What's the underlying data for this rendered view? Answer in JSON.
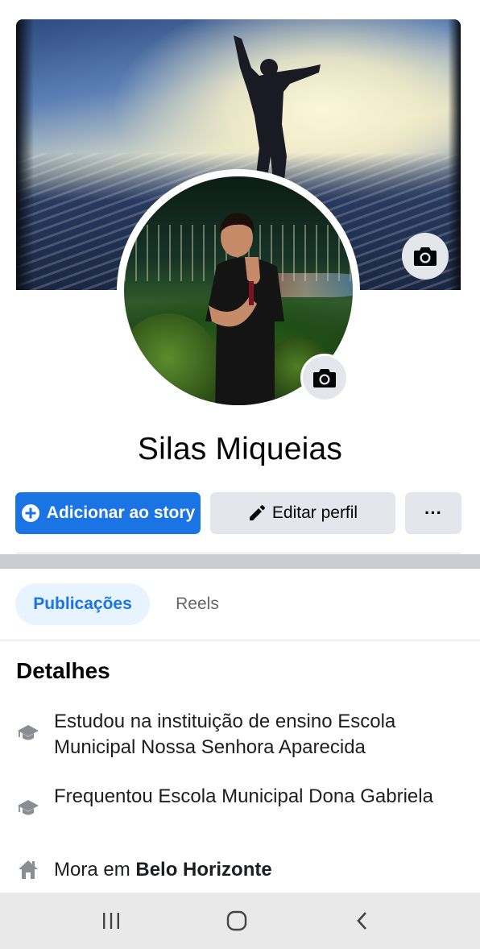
{
  "profile": {
    "name": "Silas Miqueias"
  },
  "actions": {
    "add_story_label": "Adicionar ao story",
    "edit_profile_label": "Editar perfil",
    "more_label": "···"
  },
  "tabs": [
    {
      "label": "Publicações",
      "active": true
    },
    {
      "label": "Reels",
      "active": false
    }
  ],
  "details": {
    "title": "Detalhes",
    "items": [
      {
        "icon": "graduation-cap-icon",
        "text": "Estudou na instituição de ensino Escola Municipal Nossa Senhora Aparecida"
      },
      {
        "icon": "graduation-cap-icon",
        "text": "Frequentou Escola Municipal Dona Gabriela"
      },
      {
        "icon": "home-icon",
        "prefix": "Mora em ",
        "place": "Belo Horizonte"
      }
    ]
  },
  "navbar": {
    "items": [
      "recent-apps-icon",
      "home-circle-icon",
      "back-icon"
    ]
  },
  "colors": {
    "primary": "#1b74e4",
    "button_gray": "#e4e6eb",
    "tab_active_bg": "#e7f3ff",
    "secondary_text": "#65676b"
  }
}
